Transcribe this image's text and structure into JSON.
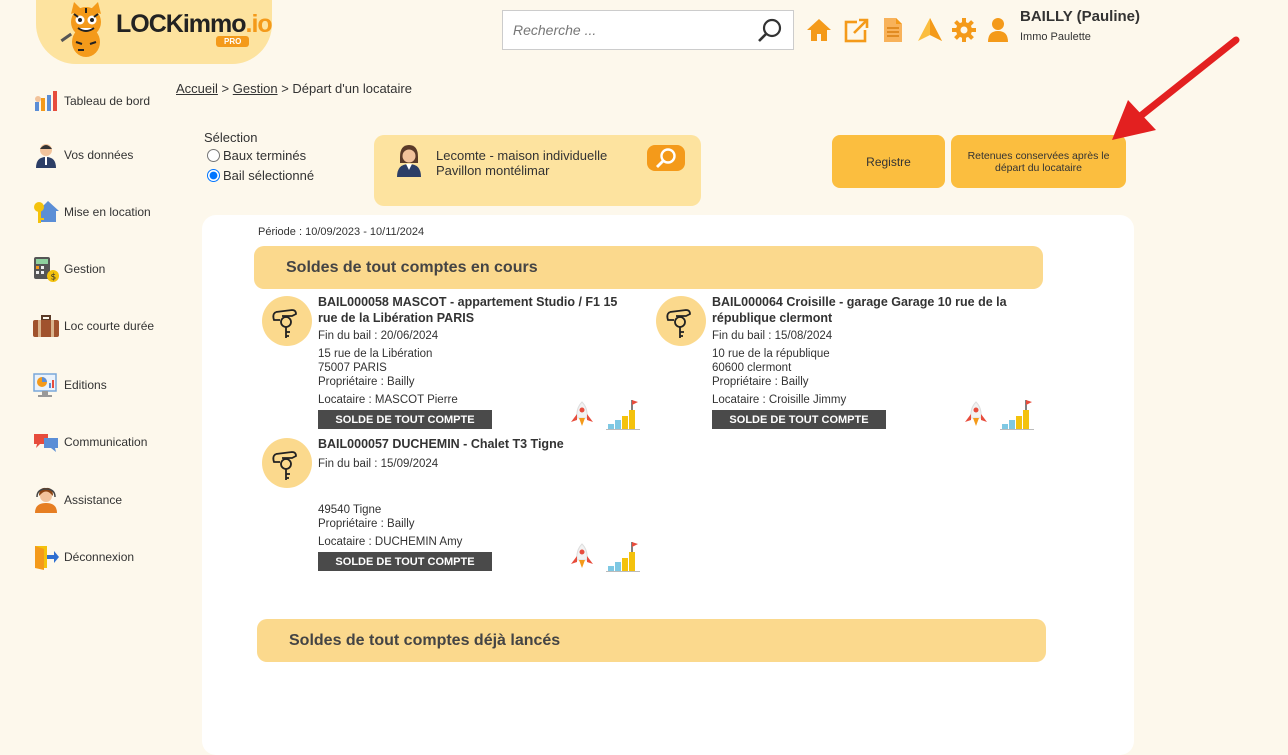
{
  "header": {
    "logo": {
      "main": "LOCKimmo",
      "suffix": ".io",
      "badge": "PRO"
    },
    "search": {
      "placeholder": "Recherche ..."
    },
    "icons": [
      "home-icon",
      "external-link-icon",
      "document-icon",
      "paper-plane-icon",
      "gear-icon",
      "user-icon"
    ],
    "user": {
      "name": "BAILLY (Pauline)",
      "agency": "Immo Paulette"
    }
  },
  "sidebar": {
    "items": [
      {
        "label": "Tableau de bord",
        "icon": "dashboard-icon"
      },
      {
        "label": "Vos données",
        "icon": "person-icon"
      },
      {
        "label": "Mise en location",
        "icon": "house-key-icon"
      },
      {
        "label": "Gestion",
        "icon": "calculator-icon"
      },
      {
        "label": "Loc courte durée",
        "icon": "suitcase-icon"
      },
      {
        "label": "Editions",
        "icon": "report-icon"
      },
      {
        "label": "Communication",
        "icon": "chat-bubbles-icon"
      },
      {
        "label": "Assistance",
        "icon": "support-agent-icon"
      },
      {
        "label": "Déconnexion",
        "icon": "logout-icon"
      }
    ]
  },
  "breadcrumb": {
    "home": "Accueil",
    "sep": ">",
    "section": "Gestion",
    "current": "Départ d'un locataire"
  },
  "selection": {
    "title": "Sélection",
    "options": [
      "Baux terminés",
      "Bail sélectionné"
    ],
    "selected": "Bail sélectionné"
  },
  "selected_lease": {
    "text": "Lecomte - maison individuelle Pavillon montélimar"
  },
  "buttons": {
    "registre": "Registre",
    "retenues": "Retenues conservées après le départ du locataire"
  },
  "periode": "Période : 10/09/2023 - 10/11/2024",
  "sections": {
    "en_cours": "Soldes de tout comptes en cours",
    "lances": "Soldes de tout comptes déjà lancés"
  },
  "leases": [
    {
      "title": "BAIL000058 MASCOT - appartement Studio / F1 15 rue de la Libération PARIS",
      "fin": "Fin du bail : 20/06/2024",
      "address1": "15 rue de la Libération",
      "address2": "75007 PARIS",
      "proprietaire": "Propriétaire : Bailly",
      "locataire": "Locataire : MASCOT Pierre",
      "button": "SOLDE DE TOUT COMPTE"
    },
    {
      "title": "BAIL000064 Croisille - garage Garage 10 rue de la république clermont",
      "fin": "Fin du bail : 15/08/2024",
      "address1": "10 rue de la république",
      "address2": "60600 clermont",
      "proprietaire": "Propriétaire : Bailly",
      "locataire": "Locataire : Croisille Jimmy",
      "button": "SOLDE DE TOUT COMPTE"
    },
    {
      "title": "BAIL000057 DUCHEMIN - Chalet T3 Tigne",
      "fin": "Fin du bail : 15/09/2024",
      "address1": "",
      "address2": "49540 Tigne",
      "proprietaire": "Propriétaire : Bailly",
      "locataire": "Locataire : DUCHEMIN Amy",
      "button": "SOLDE DE TOUT COMPTE"
    }
  ],
  "colors": {
    "accent": "#f49a1a",
    "banner": "#fbd98d",
    "button_yellow": "#fbbe3f",
    "arrow": "#e32020"
  }
}
